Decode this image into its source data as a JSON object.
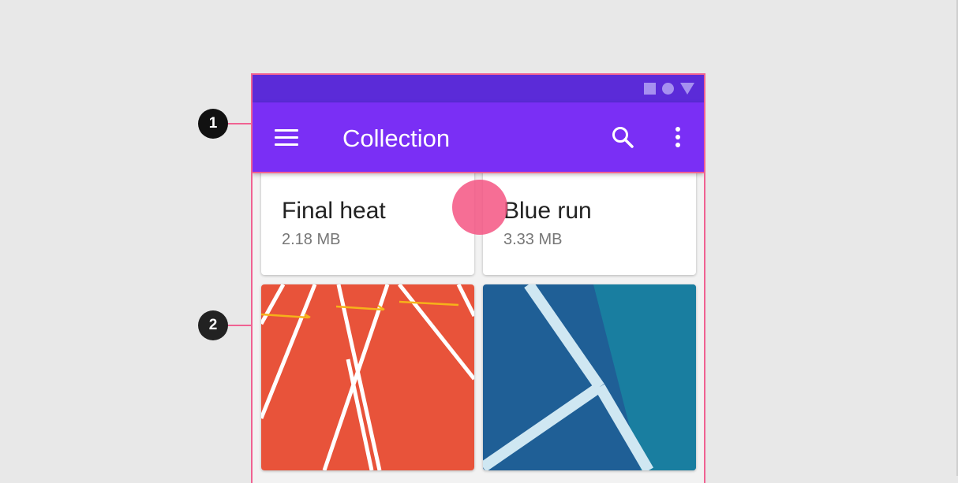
{
  "callouts": [
    {
      "number": "1"
    },
    {
      "number": "2"
    }
  ],
  "status_bar": {
    "icons": [
      "square-icon",
      "circle-icon",
      "triangle-icon"
    ],
    "color": "#5b2bd8"
  },
  "app_bar": {
    "title": "Collection",
    "menu_icon": "menu-icon",
    "search_icon": "search-icon",
    "more_icon": "more-vert-icon",
    "color": "#7a2ff5"
  },
  "cards": [
    {
      "title": "Final heat",
      "size": "2.18 MB"
    },
    {
      "title": "Blue run",
      "size": "3.33 MB"
    },
    {
      "image": "orange running track with white lane lines"
    },
    {
      "image": "blue court with white lines"
    }
  ],
  "colors": {
    "accent_outline": "#f06292",
    "touch_indicator": "#f55582",
    "track": "#e8533a",
    "court": "#1f5f96"
  }
}
